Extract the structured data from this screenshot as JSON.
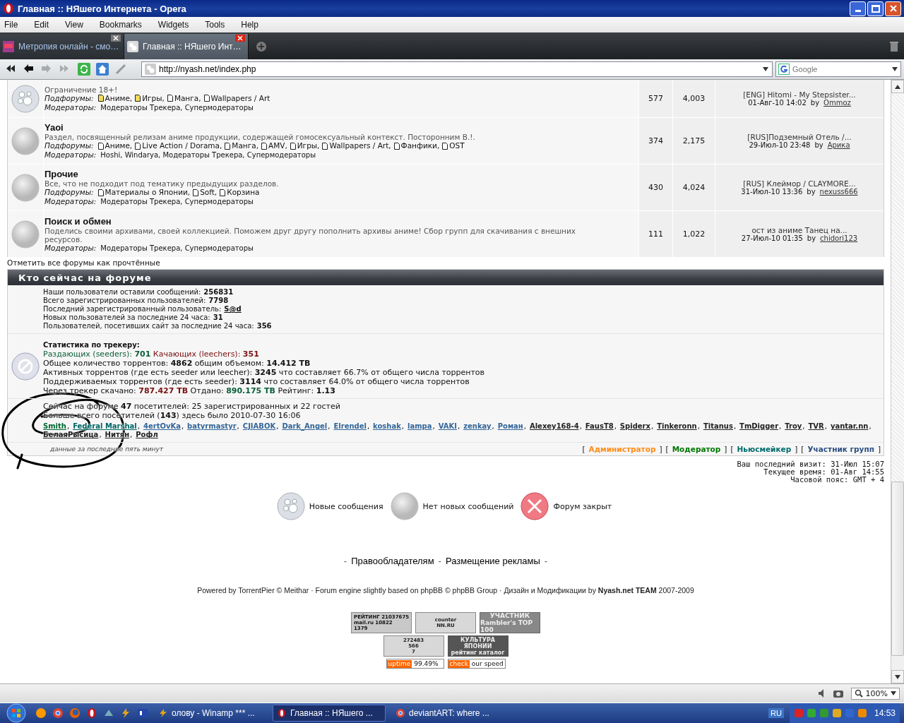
{
  "window": {
    "title": "Главная :: НЯшего Интернета - Opera"
  },
  "menu": [
    "File",
    "Edit",
    "View",
    "Bookmarks",
    "Widgets",
    "Tools",
    "Help"
  ],
  "tabs": [
    {
      "label": "Метропия онлайн - смо…",
      "selected": false
    },
    {
      "label": "Главная :: НЯшего Инт…",
      "selected": true
    }
  ],
  "address": {
    "url": "http://nyash.net/index.php"
  },
  "search": {
    "placeholder": "Google"
  },
  "forums": [
    {
      "kind": "new",
      "description": "Ограничение 18+!",
      "subforums_label": "Подфорумы:",
      "subforums": [
        {
          "name": "Аниме,",
          "unread": true
        },
        {
          "name": "Игры,",
          "unread": true
        },
        {
          "name": "Манга,",
          "unread": false
        },
        {
          "name": "Wallpapers / Art",
          "unread": false
        }
      ],
      "moderators_label": "Модераторы:",
      "moderators": "Модераторы Трекера, Супермодераторы",
      "topics": "577",
      "posts": "4,003",
      "last_title": "[ENG] Hitomi - My Stepsister...",
      "last_time": "01-Авг-10 14:02",
      "by": "by",
      "last_user": "Ommoz"
    },
    {
      "kind": "no_new",
      "title": "Yaoi",
      "description": "Раздел, посвященный релизам аниме продукции, содержащей гомосексуальный контекст. Посторонним В.!.",
      "subforums_label": "Подфорумы:",
      "subforums": [
        {
          "name": "Аниме,",
          "unread": false
        },
        {
          "name": "Live Action / Dorama,",
          "unread": false
        },
        {
          "name": "Манга,",
          "unread": false
        },
        {
          "name": "AMV,",
          "unread": false
        },
        {
          "name": "Игры,",
          "unread": false
        },
        {
          "name": "Wallpapers / Art,",
          "unread": false
        },
        {
          "name": "Фанфики,",
          "unread": false
        },
        {
          "name": "OST",
          "unread": false
        }
      ],
      "moderators_label": "Модераторы:",
      "moderators": "Hoshi, Windarya, Модераторы Трекера, Супермодераторы",
      "topics": "374",
      "posts": "2,175",
      "last_title": "[RUS]Подземный Отель /...",
      "last_time": "29-Июл-10 23:48",
      "by": "by",
      "last_user": "Арика"
    },
    {
      "kind": "no_new",
      "title": "Прочие",
      "description": "Все, что не подходит под тематику предыдущих разделов.",
      "subforums_label": "Подфорумы:",
      "subforums": [
        {
          "name": "Материалы о Японии,",
          "unread": false
        },
        {
          "name": "Soft,",
          "unread": false
        },
        {
          "name": "Корзина",
          "unread": false
        }
      ],
      "moderators_label": "Модераторы:",
      "moderators": "Модераторы Трекера, Супермодераторы",
      "topics": "430",
      "posts": "4,024",
      "last_title": "[RUS] Клеймор / CLAYMORE...",
      "last_time": "31-Июл-10 13:36",
      "by": "by",
      "last_user": "nexuss666"
    },
    {
      "kind": "no_new",
      "title": "Поиск и обмен",
      "description": "Поделись своими архивами, своей коллекцией. Поможем друг другу пополнить архивы аниме! Сбор групп для скачивания с внешних ресурсов.",
      "moderators_label": "Модераторы:",
      "moderators": "Модераторы Трекера, Супермодераторы",
      "topics": "111",
      "posts": "1,022",
      "last_title": "ост из аниме Танец на...",
      "last_time": "27-Июл-10 01:35",
      "by": "by",
      "last_user": "chidori123"
    }
  ],
  "mark_read": "Отметить все форумы как прочтённые",
  "who_online": {
    "title": "Кто сейчас на форуме",
    "stats": [
      {
        "label": "Наши пользователи оставили сообщений:",
        "value": "256831",
        "kind": "number"
      },
      {
        "label": "Всего зарегистрированных пользователей:",
        "value": "7798",
        "kind": "number"
      },
      {
        "label": "Последний зарегистрированный пользователь:",
        "value": "S@d",
        "kind": "link"
      },
      {
        "label": "Новых пользователей за последние 24 часа:",
        "value": "31",
        "kind": "number"
      },
      {
        "label": "Пользователей, посетивших сайт за последние 24 часа:",
        "value": "356",
        "kind": "number"
      }
    ],
    "tracker_title": "Статистика по трекеру:",
    "tracker_lines": [
      [
        {
          "text": "Раздающих (seeders): **701**",
          "kind": "seed"
        },
        {
          "text": " Качающих (leechers): **351**",
          "kind": "leech"
        }
      ],
      [
        {
          "text": "Общее количество торрентов: **4862** общим объемом: **14.412 TB**",
          "kind": "plain"
        }
      ],
      [
        {
          "text": "Активных торрентов (где есть seeder или leecher): **3245** что составляет 66.7% от общего числа торрентов",
          "kind": "plain"
        }
      ],
      [
        {
          "text": "Поддерживаемых торрентов (где есть seeder): **3114** что составляет 64.0% от общего числа торрентов",
          "kind": "plain"
        }
      ],
      [
        {
          "text": "Через трекер скачано: ",
          "kind": "plain"
        },
        {
          "text": "**787.427 TB**",
          "kind": "leech"
        },
        {
          "text": " Отдано: ",
          "kind": "plain"
        },
        {
          "text": "**890.175 TB**",
          "kind": "seed"
        },
        {
          "text": " Рейтинг: **1.13**",
          "kind": "plain"
        }
      ]
    ],
    "online_lines": [
      "Сейчас на форуме **47** посетителей: 25 зарегистрированных и 22 гостей",
      "Больше всего посетителей (**143**) здесь было 2010-07-30 16:06"
    ],
    "users": [
      {
        "name": "Smith",
        "sep": ",",
        "color": "#006633"
      },
      {
        "name": "Federal Marshal",
        "sep": ",",
        "color": "#006666"
      },
      {
        "name": "4ertOvKa",
        "sep": ",",
        "color": "#336699"
      },
      {
        "name": "batyrmastyr",
        "sep": ",",
        "color": "#336699"
      },
      {
        "name": "CJIABOK",
        "sep": ",",
        "color": "#336699"
      },
      {
        "name": "Dark_Angel",
        "sep": ",",
        "color": "#336699"
      },
      {
        "name": "Elrendel",
        "sep": ",",
        "color": "#336699"
      },
      {
        "name": "koshak",
        "sep": ",",
        "color": "#336699"
      },
      {
        "name": "lampa",
        "sep": ",",
        "color": "#336699"
      },
      {
        "name": "VAKI",
        "sep": ",",
        "color": "#336699"
      },
      {
        "name": "zenkay",
        "sep": ",",
        "color": "#336699"
      },
      {
        "name": "Роман",
        "sep": ",",
        "color": "#336699"
      },
      {
        "name": "Alexey168-4",
        "sep": ",",
        "color": "#222222"
      },
      {
        "name": "FausT8",
        "sep": ",",
        "color": "#222222"
      },
      {
        "name": "Spiderx",
        "sep": ",",
        "color": "#222222"
      },
      {
        "name": "Tinkeronn",
        "sep": ",",
        "color": "#222222"
      },
      {
        "name": "Titanus",
        "sep": ",",
        "color": "#222222"
      },
      {
        "name": "TmDigger",
        "sep": ",",
        "color": "#222222"
      },
      {
        "name": "Troy",
        "sep": ",",
        "color": "#222222"
      },
      {
        "name": "TVR",
        "sep": ",",
        "color": "#222222"
      },
      {
        "name": "yantar.nn",
        "sep": ",",
        "color": "#222222"
      },
      {
        "name": "БелаяРысица",
        "sep": ",",
        "color": "#222222"
      },
      {
        "name": "Нитян",
        "sep": ",",
        "color": "#222222"
      },
      {
        "name": "Рофл",
        "color": "#222222"
      }
    ],
    "note": "данные за последние пять минут",
    "groups": [
      {
        "open": "[",
        "label": "Администратор",
        "close": "]",
        "color": "#ff8c1a"
      },
      {
        "open": "[",
        "label": "Модератор",
        "close": "]",
        "color": "#007700"
      },
      {
        "open": "[",
        "label": "Ньюсмейкер",
        "close": "]",
        "color": "#006b6b"
      },
      {
        "open": "[",
        "label": "Участник групп",
        "close": "]",
        "color": "#2b4f81"
      }
    ]
  },
  "visit_info": [
    "Ваш последний визит: 31-Июл 15:07",
    "Текущее время: 01-Авг 14:55",
    "Часовой пояс: GMT + 4"
  ],
  "legend": [
    {
      "kind": "new",
      "label": "Новые сообщения"
    },
    {
      "kind": "no_new",
      "label": "Нет новых сообщений"
    },
    {
      "kind": "locked",
      "label": "Форум закрыт"
    }
  ],
  "footer_links": [
    {
      "kind": "sep",
      "text": "-"
    },
    {
      "kind": "link",
      "text": "Правообладателям"
    },
    {
      "kind": "sep",
      "text": "-"
    },
    {
      "kind": "link",
      "text": "Размещение рекламы"
    },
    {
      "kind": "sep",
      "text": "-"
    }
  ],
  "powered": "Powered by TorrentPier © Meithar · Forum engine slightly based on phpBB © phpBB Group · Дизайн и Модификации by **Nyash.net TEAM** 2007-2009",
  "counters": [
    [
      {
        "kind": "mailru",
        "lines": [
          "РЕЙТИНГ 21037675",
          "mail.ru 10822",
          "1379"
        ]
      },
      {
        "kind": "grey",
        "lines": [
          "counter",
          "NN.RU"
        ]
      },
      {
        "kind": "rambler",
        "lines": [
          "УЧАСТНИК",
          "Rambler's TOP 100"
        ]
      }
    ],
    [
      {
        "kind": "grey",
        "lines": [
          "272483",
          "566",
          "7"
        ]
      },
      {
        "kind": "dark",
        "lines": [
          "КУЛЬТУРА",
          "ЯПОНИИ",
          "рейтинг каталог"
        ]
      }
    ],
    [
      {
        "kind": "strip",
        "lines": [
          "uptime",
          "99.49%"
        ]
      },
      {
        "kind": "strip",
        "lines": [
          "check",
          "our speed"
        ]
      }
    ]
  ],
  "status_bar": {
    "zoom": "100%"
  },
  "taskbar": {
    "tasks": [
      {
        "label": "олову - Winamp *** ...",
        "selected": false
      },
      {
        "label": "Главная :: НЯшего ...",
        "selected": true
      },
      {
        "label": "deviantART: where ...",
        "selected": false
      }
    ],
    "language": "RU",
    "clock": "14:53"
  }
}
